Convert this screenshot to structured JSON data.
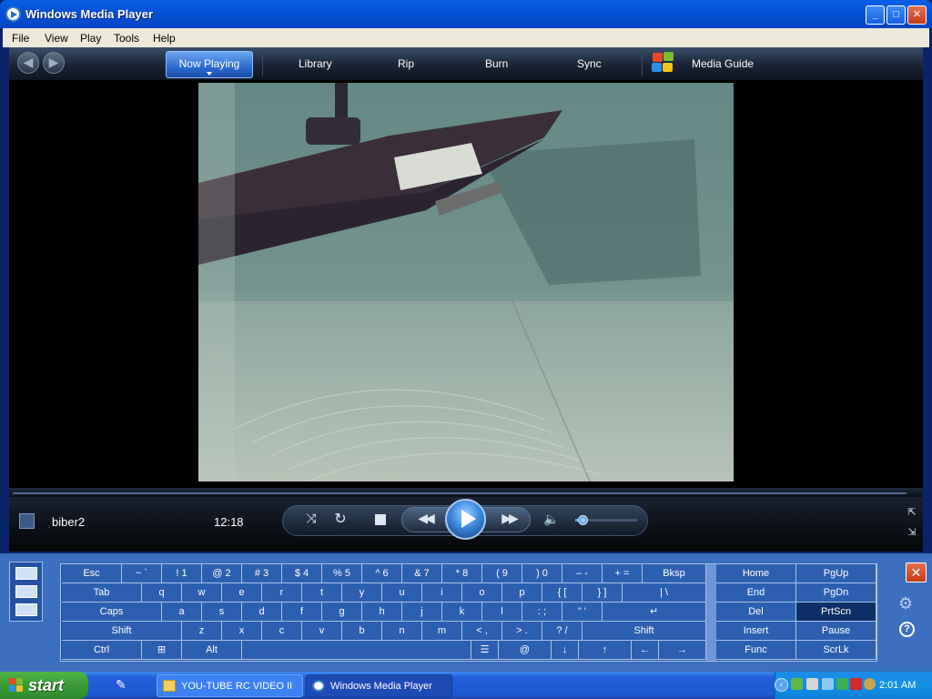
{
  "window": {
    "title": "Windows Media Player",
    "min": "_",
    "max": "□",
    "close": "✕"
  },
  "menu": [
    "File",
    "View",
    "Play",
    "Tools",
    "Help"
  ],
  "taskbar_tabs": {
    "now_playing": "Now Playing",
    "library": "Library",
    "rip": "Rip",
    "burn": "Burn",
    "sync": "Sync",
    "media_guide": "Media Guide"
  },
  "player": {
    "track": "biber2",
    "time": "12:18",
    "volume_fraction": 0.12
  },
  "keyboard": {
    "rows": [
      [
        [
          "Esc",
          ""
        ],
        [
          "~ `",
          ""
        ],
        [
          "! 1",
          ""
        ],
        [
          "@ 2",
          ""
        ],
        [
          "# 3",
          ""
        ],
        [
          "$ 4",
          ""
        ],
        [
          "% 5",
          ""
        ],
        [
          "^ 6",
          ""
        ],
        [
          "& 7",
          ""
        ],
        [
          "* 8",
          ""
        ],
        [
          "( 9",
          ""
        ],
        [
          ") 0",
          ""
        ],
        [
          "– -",
          ""
        ],
        [
          "+ =",
          ""
        ],
        [
          "Bksp",
          ""
        ]
      ],
      [
        [
          "Tab",
          ""
        ],
        [
          "q",
          ""
        ],
        [
          "w",
          ""
        ],
        [
          "e",
          ""
        ],
        [
          "r",
          ""
        ],
        [
          "t",
          ""
        ],
        [
          "y",
          ""
        ],
        [
          "u",
          ""
        ],
        [
          "i",
          ""
        ],
        [
          "o",
          ""
        ],
        [
          "p",
          ""
        ],
        [
          "{ [",
          ""
        ],
        [
          "} ]",
          ""
        ],
        [
          "| \\",
          ""
        ]
      ],
      [
        [
          "Caps",
          ""
        ],
        [
          "a",
          ""
        ],
        [
          "s",
          ""
        ],
        [
          "d",
          ""
        ],
        [
          "f",
          ""
        ],
        [
          "g",
          ""
        ],
        [
          "h",
          ""
        ],
        [
          "j",
          ""
        ],
        [
          "k",
          ""
        ],
        [
          "l",
          ""
        ],
        [
          ": ;",
          ""
        ],
        [
          "\" '",
          ""
        ],
        [
          "↵",
          ""
        ]
      ],
      [
        [
          "Shift",
          ""
        ],
        [
          "z",
          ""
        ],
        [
          "x",
          ""
        ],
        [
          "c",
          ""
        ],
        [
          "v",
          ""
        ],
        [
          "b",
          ""
        ],
        [
          "n",
          ""
        ],
        [
          "m",
          ""
        ],
        [
          "< ,",
          ""
        ],
        [
          "> .",
          ""
        ],
        [
          "? /",
          ""
        ],
        [
          "Shift",
          ""
        ]
      ],
      [
        [
          "Ctrl",
          ""
        ],
        [
          "⊞",
          ""
        ],
        [
          "Alt",
          ""
        ],
        [
          "",
          ""
        ],
        [
          "☰",
          ""
        ],
        [
          "@",
          ""
        ],
        [
          "↓",
          ""
        ],
        [
          "↑",
          ""
        ],
        [
          "←",
          ""
        ],
        [
          "→",
          ""
        ]
      ]
    ],
    "nav": [
      [
        "Home",
        "PgUp"
      ],
      [
        "End",
        "PgDn"
      ],
      [
        "Del",
        "PrtScn"
      ],
      [
        "Insert",
        "Pause"
      ],
      [
        "Func",
        "ScrLk"
      ]
    ],
    "highlighted": "PrtScn",
    "close": "✕",
    "help": "?"
  },
  "taskbar": {
    "start": "start",
    "tasks": [
      "YOU-TUBE RC VIDEO II",
      "Windows Media Player"
    ],
    "clock": "2:01 AM"
  }
}
